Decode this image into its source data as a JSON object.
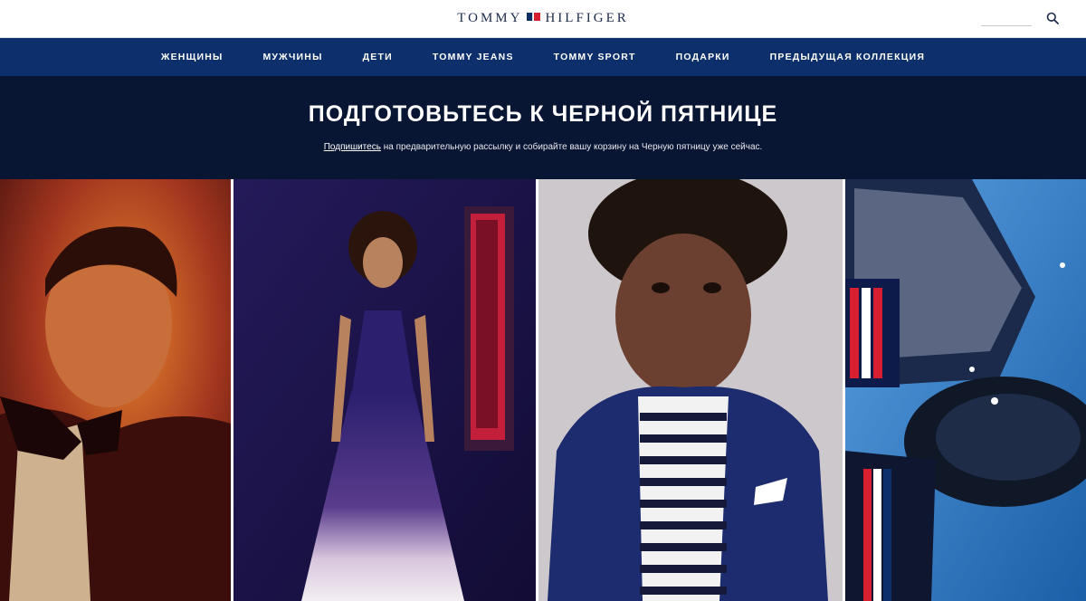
{
  "header": {
    "logo_left": "TOMMY",
    "logo_right": "HILFIGER",
    "search_placeholder": ""
  },
  "nav": {
    "items": [
      "ЖЕНЩИНЫ",
      "МУЖЧИНЫ",
      "ДЕТИ",
      "TOMMY JEANS",
      "TOMMY SPORT",
      "ПОДАРКИ",
      "ПРЕДЫДУЩАЯ КОЛЛЕКЦИЯ"
    ]
  },
  "promo": {
    "title": "ПОДГОТОВЬТЕСЬ К ЧЕРНОЙ ПЯТНИЦЕ",
    "link_text": "Подпишитесь",
    "rest_text": " на предварительную рассылку и собирайте вашу корзину на Черную пятницу уже сейчас."
  },
  "tiles": [
    {
      "name": "men",
      "icon": "man-in-tuxedo-photo"
    },
    {
      "name": "women",
      "icon": "woman-in-pleated-gown-photo"
    },
    {
      "name": "kids",
      "icon": "boy-in-blazer-photo"
    },
    {
      "name": "accessories",
      "icon": "shoes-and-wallet-photo"
    }
  ],
  "colors": {
    "nav_bg": "#0d2f6b",
    "promo_bg": "#081533",
    "brand_red": "#d61f31",
    "brand_navy": "#0c2e63"
  }
}
